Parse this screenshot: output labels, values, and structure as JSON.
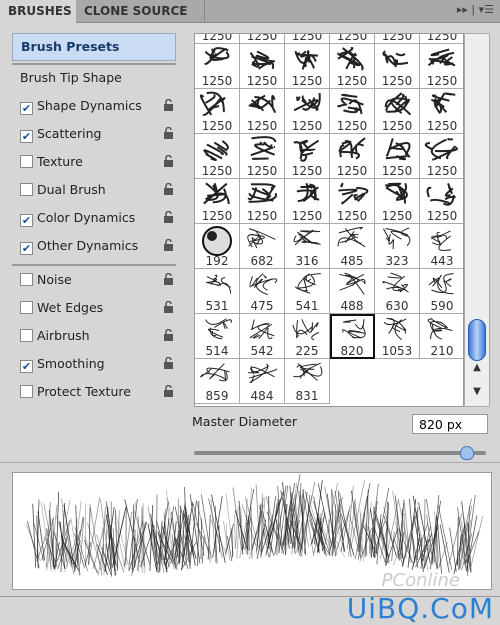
{
  "tabs": [
    {
      "label": "BRUSHES",
      "active": true
    },
    {
      "label": "CLONE SOURCE",
      "active": false
    }
  ],
  "tab_icons": {
    "collapse": "double-arrow-icon",
    "menu": "panel-menu-icon"
  },
  "sidebar": {
    "preset": "Brush Presets",
    "tip_shape": "Brush Tip Shape",
    "items": [
      {
        "label": "Shape Dynamics",
        "checked": true
      },
      {
        "label": "Scattering",
        "checked": true
      },
      {
        "label": "Texture",
        "checked": false
      },
      {
        "label": "Dual Brush",
        "checked": false
      },
      {
        "label": "Color Dynamics",
        "checked": true
      },
      {
        "label": "Other Dynamics",
        "checked": true
      }
    ],
    "items2": [
      {
        "label": "Noise",
        "checked": false
      },
      {
        "label": "Wet Edges",
        "checked": false
      },
      {
        "label": "Airbrush",
        "checked": false
      },
      {
        "label": "Smoothing",
        "checked": true
      },
      {
        "label": "Protect Texture",
        "checked": false
      }
    ]
  },
  "brushes": [
    "1250",
    "1250",
    "1250",
    "1250",
    "1250",
    "1250",
    "1250",
    "1250",
    "1250",
    "1250",
    "1250",
    "1250",
    "1250",
    "1250",
    "1250",
    "1250",
    "1250",
    "1250",
    "1250",
    "1250",
    "1250",
    "1250",
    "1250",
    "1250",
    "1250",
    "1250",
    "1250",
    "1250",
    "1250",
    "1250",
    "192",
    "682",
    "316",
    "485",
    "323",
    "443",
    "531",
    "475",
    "541",
    "488",
    "630",
    "590",
    "514",
    "542",
    "225",
    "820",
    "1053",
    "210",
    "859",
    "484",
    "831"
  ],
  "selected_brush": "820",
  "master_diameter": {
    "label": "Master Diameter",
    "value": "820 px",
    "slider_fraction": 0.93
  },
  "watermark": {
    "main": "UiBQ.CoM",
    "faint": "PConline"
  }
}
